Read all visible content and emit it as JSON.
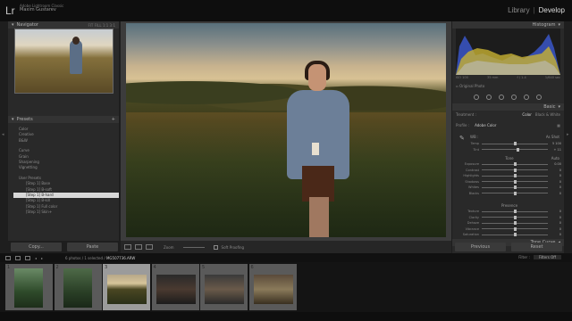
{
  "app": {
    "logo": "Lr",
    "catalog_line": "Adobe Lightroom Classic",
    "owner": "Maxim Gustarev",
    "modules": [
      "Library",
      "Develop"
    ],
    "active_module": "Develop"
  },
  "navigator": {
    "title": "Navigator",
    "zoom_options": "FIT  FILL  1:1  3:1"
  },
  "presets": {
    "title": "Presets",
    "items": [
      {
        "label": "Color",
        "kind": "group"
      },
      {
        "label": "Creative",
        "kind": "group"
      },
      {
        "label": "B&W",
        "kind": "group"
      },
      {
        "label": "",
        "kind": "gap"
      },
      {
        "label": "Curve",
        "kind": "group"
      },
      {
        "label": "Grain",
        "kind": "group"
      },
      {
        "label": "Sharpening",
        "kind": "group"
      },
      {
        "label": "Vignetting",
        "kind": "group"
      },
      {
        "label": "",
        "kind": "gap"
      },
      {
        "label": "User Presets",
        "kind": "group"
      },
      {
        "label": "[Step 1] Base",
        "kind": "child"
      },
      {
        "label": "[Step 1]     B-soft",
        "kind": "child"
      },
      {
        "label": "[Step 1]     B-hard",
        "kind": "selected"
      },
      {
        "label": "[Step 1]     B-kill",
        "kind": "child"
      },
      {
        "label": "[Step 1]     Full color",
        "kind": "child"
      },
      {
        "label": "[Step 1]     Skin+",
        "kind": "child"
      }
    ]
  },
  "left_buttons": {
    "copy": "Copy...",
    "paste": "Paste"
  },
  "toolbar": {
    "zoom_label": "Zoom",
    "soft_proofing": "Soft Proofing"
  },
  "histogram": {
    "title": "Histogram",
    "iso": "ISO 100",
    "focal": "35 mm",
    "aperture": "f / 1.4",
    "shutter": "1/640 sec",
    "original_photo": "Original Photo"
  },
  "basic": {
    "title": "Basic",
    "treatment_label": "Treatment :",
    "treatment_color": "Color",
    "treatment_bw": "Black & White",
    "profile_label": "Profile :",
    "profile_value": "Adobe Color",
    "wb_label": "WB :",
    "wb_value": "As Shot",
    "sliders": [
      {
        "group": "wb",
        "label": "Temp",
        "value": "5 100",
        "pos": 0.5
      },
      {
        "group": "wb",
        "label": "Tint",
        "value": "+ 11",
        "pos": 0.55
      },
      {
        "group": "tone",
        "label": "Exposure",
        "value": "0.00",
        "pos": 0.5
      },
      {
        "group": "tone",
        "label": "Contrast",
        "value": "0",
        "pos": 0.5
      },
      {
        "group": "tone",
        "label": "Highlights",
        "value": "0",
        "pos": 0.5
      },
      {
        "group": "tone",
        "label": "Shadows",
        "value": "0",
        "pos": 0.5
      },
      {
        "group": "tone",
        "label": "Whites",
        "value": "0",
        "pos": 0.5
      },
      {
        "group": "tone",
        "label": "Blacks",
        "value": "0",
        "pos": 0.5
      },
      {
        "group": "presence",
        "label": "Texture",
        "value": "0",
        "pos": 0.5
      },
      {
        "group": "presence",
        "label": "Clarity",
        "value": "0",
        "pos": 0.5
      },
      {
        "group": "presence",
        "label": "Dehaze",
        "value": "0",
        "pos": 0.5
      },
      {
        "group": "presence",
        "label": "Vibrance",
        "value": "0",
        "pos": 0.5
      },
      {
        "group": "presence",
        "label": "Saturation",
        "value": "0",
        "pos": 0.5
      }
    ],
    "tone_title": "Tone",
    "tone_auto": "Auto",
    "presence_title": "Presence"
  },
  "tone_curve": {
    "title": "Tone Curve"
  },
  "right_buttons": {
    "previous": "Previous",
    "reset": "Reset"
  },
  "filmstrip": {
    "count_text": "6 photos / 1 selected /",
    "filename": "MG507736.ARW",
    "filter_label": "Filter :",
    "filter_value": "Filters Off",
    "cells": [
      {
        "num": "1",
        "selected": false
      },
      {
        "num": "2",
        "selected": false
      },
      {
        "num": "3",
        "selected": true
      },
      {
        "num": "4",
        "selected": false
      },
      {
        "num": "5",
        "selected": false
      },
      {
        "num": "6",
        "selected": false
      }
    ]
  },
  "colors": {
    "accent": "#dedede",
    "panel_bg": "#292929",
    "selected_preset": "#d8d8d8"
  }
}
